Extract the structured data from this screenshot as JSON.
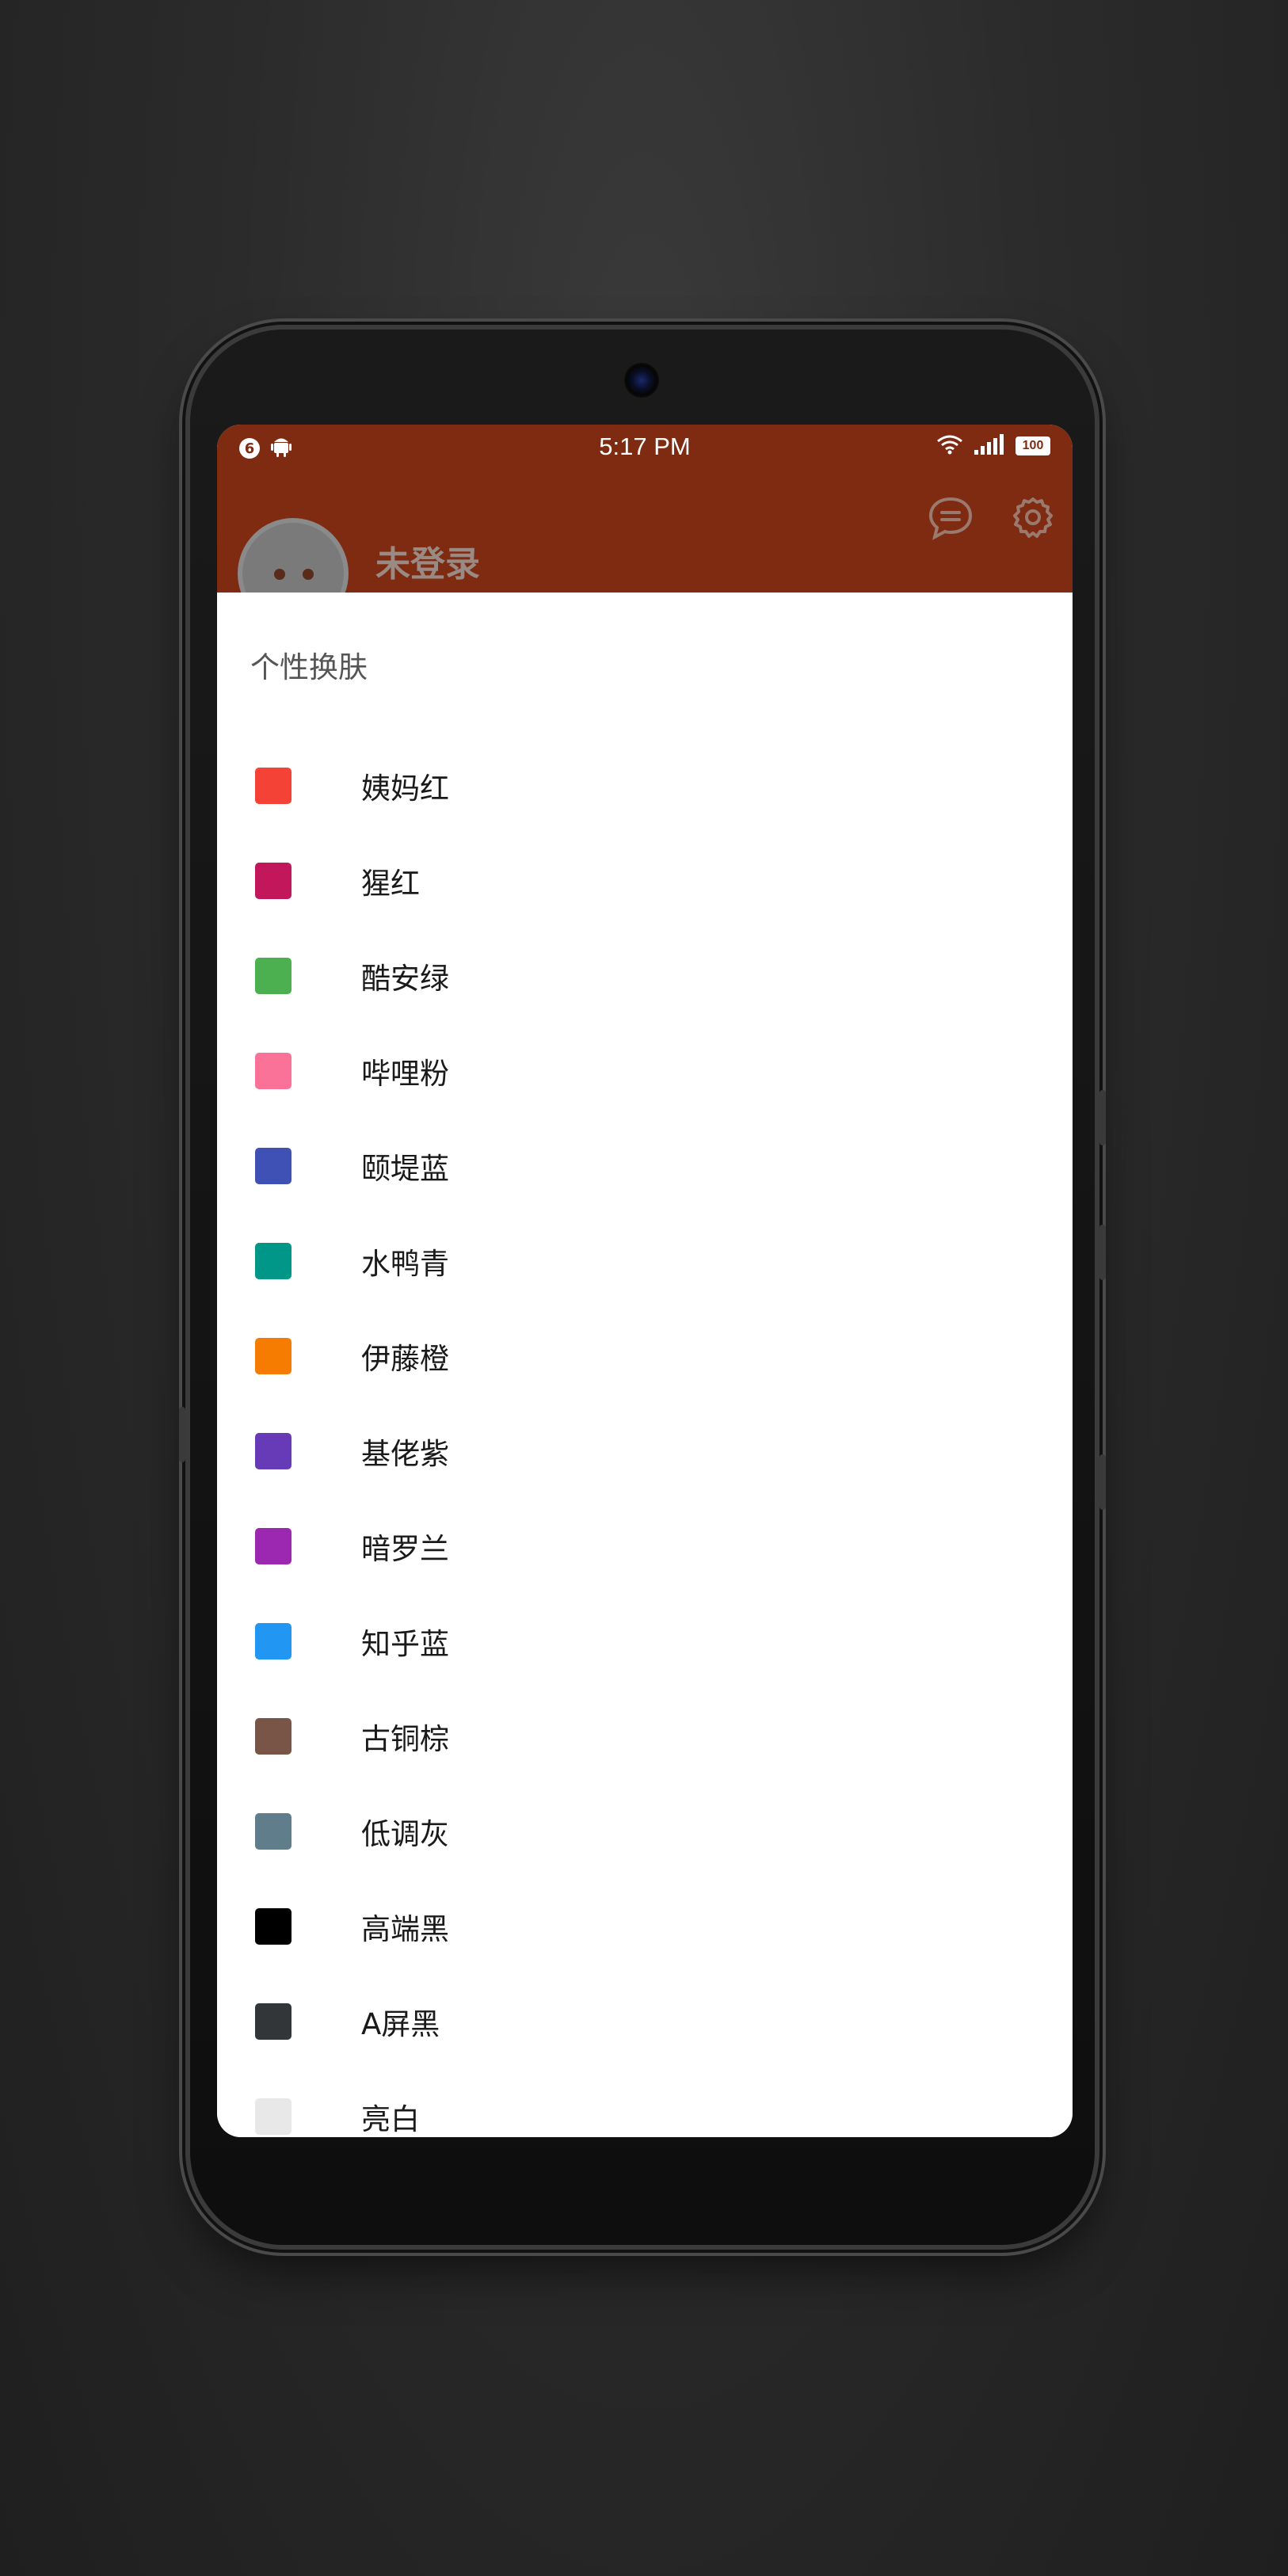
{
  "status_bar": {
    "notification_count": "6",
    "time": "5:17 PM",
    "battery": "100",
    "icons": [
      "android-icon",
      "wifi-icon",
      "signal-icon"
    ]
  },
  "header": {
    "username": "未登录",
    "background_color": "#7f2b12",
    "icons": [
      "message-icon",
      "settings-gear-icon"
    ]
  },
  "sheet": {
    "title": "个性换肤",
    "themes": [
      {
        "label": "姨妈红",
        "color": "#f44336"
      },
      {
        "label": "猩红",
        "color": "#c2185b"
      },
      {
        "label": "酷安绿",
        "color": "#4caf50"
      },
      {
        "label": "哔哩粉",
        "color": "#fb7299"
      },
      {
        "label": "颐堤蓝",
        "color": "#3f51b5"
      },
      {
        "label": "水鸭青",
        "color": "#009688"
      },
      {
        "label": "伊藤橙",
        "color": "#f57c00"
      },
      {
        "label": "基佬紫",
        "color": "#673ab7"
      },
      {
        "label": "暗罗兰",
        "color": "#9c27b0"
      },
      {
        "label": "知乎蓝",
        "color": "#2196f3"
      },
      {
        "label": "古铜棕",
        "color": "#795548"
      },
      {
        "label": "低调灰",
        "color": "#607d8b"
      },
      {
        "label": "高端黑",
        "color": "#000000"
      },
      {
        "label": "A屏黑",
        "color": "#323639"
      },
      {
        "label": "亮白",
        "color": "#e8e8e8"
      }
    ]
  }
}
